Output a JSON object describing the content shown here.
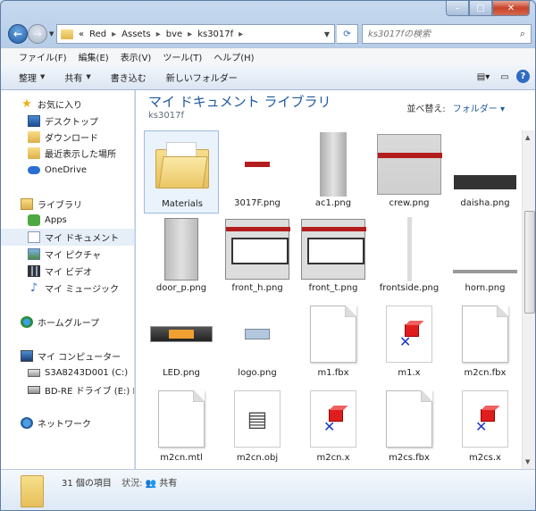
{
  "address": {
    "crumbs": [
      "Red",
      "Assets",
      "bve",
      "ks3017f"
    ],
    "prefix": "«"
  },
  "search": {
    "placeholder": "ks3017fの検索"
  },
  "menu": [
    "ファイル(F)",
    "編集(E)",
    "表示(V)",
    "ツール(T)",
    "ヘルプ(H)"
  ],
  "toolbar": {
    "organize": "整理",
    "share": "共有",
    "burn": "書き込む",
    "new_folder": "新しいフォルダー"
  },
  "sidebar": {
    "favorites": "お気に入り",
    "desktop": "デスクトップ",
    "downloads": "ダウンロード",
    "recent": "最近表示した場所",
    "onedrive": "OneDrive",
    "libraries": "ライブラリ",
    "apps": "Apps",
    "documents": "マイ ドキュメント",
    "pictures": "マイ ピクチャ",
    "videos": "マイ ビデオ",
    "music": "マイ ミュージック",
    "homegroup": "ホームグループ",
    "computer": "マイ コンピューター",
    "drive_c": "S3A8243D001 (C:)",
    "drive_e": "BD-RE ドライブ (E:) BI",
    "network": "ネットワーク"
  },
  "main": {
    "title": "マイ ドキュメント ライブラリ",
    "subtitle": "ks3017f",
    "arrange_label": "並べ替え:",
    "arrange_value": "フォルダー",
    "items": [
      {
        "name": "Materials",
        "kind": "folder"
      },
      {
        "name": "3017F.png",
        "kind": "png-3017"
      },
      {
        "name": "ac1.png",
        "kind": "png-ac1"
      },
      {
        "name": "crew.png",
        "kind": "png-crew"
      },
      {
        "name": "daisha.png",
        "kind": "png-daisha"
      },
      {
        "name": "door_p.png",
        "kind": "png-door"
      },
      {
        "name": "front_h.png",
        "kind": "png-front"
      },
      {
        "name": "front_t.png",
        "kind": "png-front"
      },
      {
        "name": "frontside.png",
        "kind": "png-side"
      },
      {
        "name": "horn.png",
        "kind": "png-horn"
      },
      {
        "name": "LED.png",
        "kind": "png-led"
      },
      {
        "name": "logo.png",
        "kind": "png-logo"
      },
      {
        "name": "m1.fbx",
        "kind": "blank"
      },
      {
        "name": "m1.x",
        "kind": "x"
      },
      {
        "name": "m2cn.fbx",
        "kind": "blank"
      },
      {
        "name": "m2cn.mtl",
        "kind": "blank"
      },
      {
        "name": "m2cn.obj",
        "kind": "obj"
      },
      {
        "name": "m2cn.x",
        "kind": "x"
      },
      {
        "name": "m2cs.fbx",
        "kind": "blank"
      },
      {
        "name": "m2cs.x",
        "kind": "x"
      }
    ]
  },
  "status": {
    "count": "31 個の項目",
    "state_label": "状況:",
    "state_value": "共有"
  }
}
